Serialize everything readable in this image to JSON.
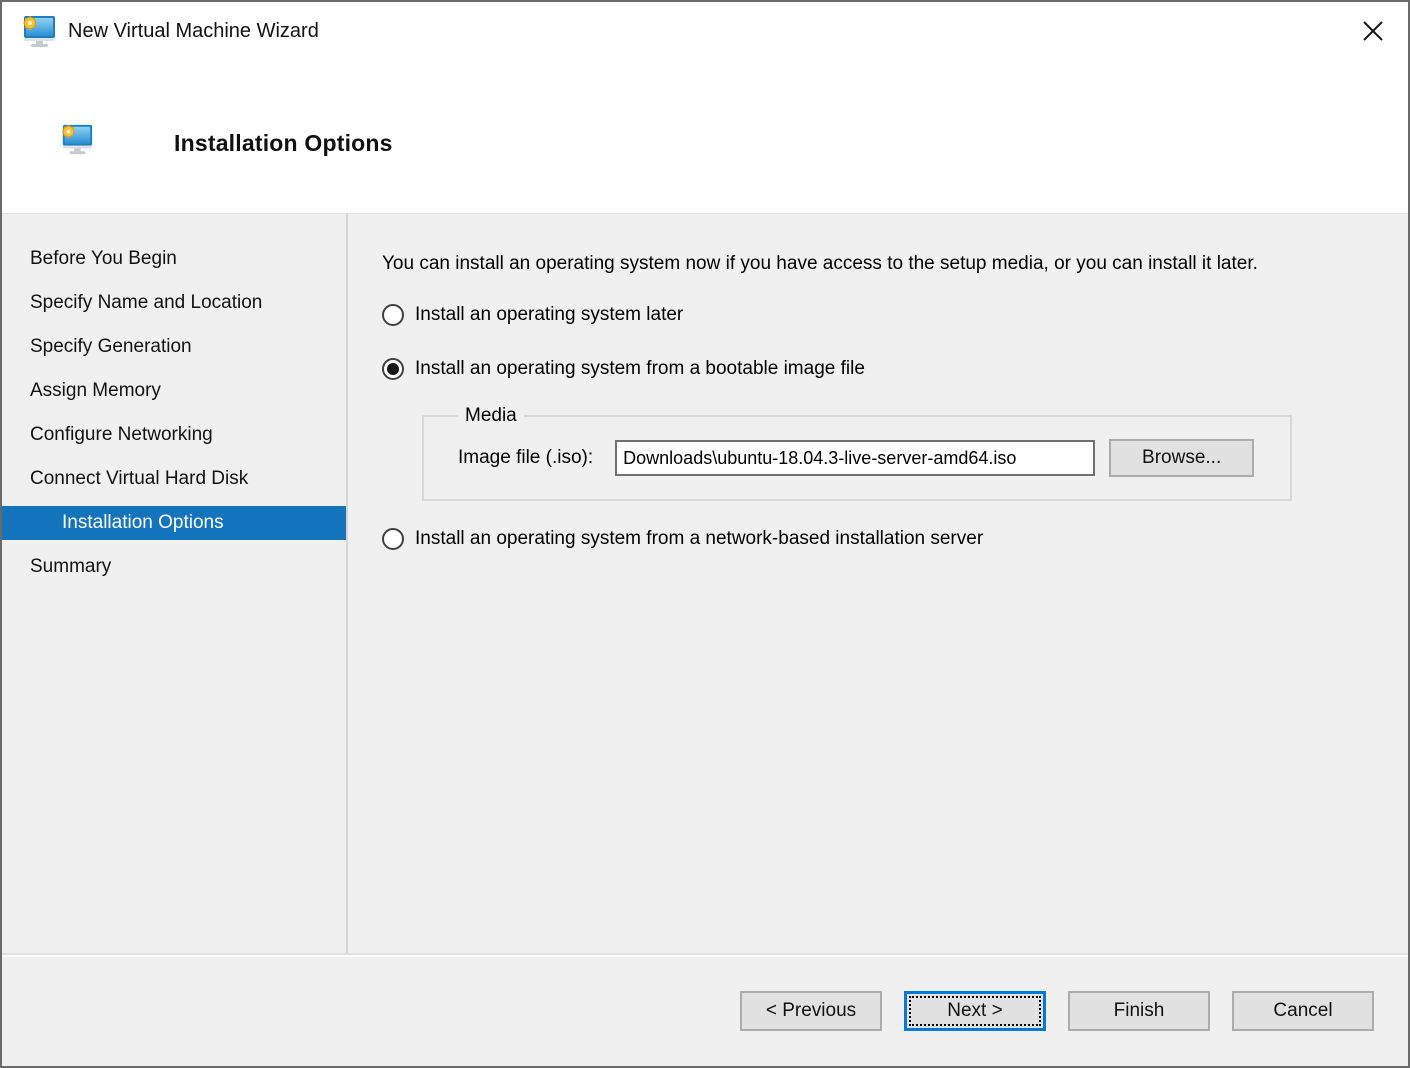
{
  "window": {
    "title": "New Virtual Machine Wizard"
  },
  "header": {
    "title": "Installation Options"
  },
  "sidebar": {
    "items": [
      {
        "label": "Before You Begin",
        "selected": false
      },
      {
        "label": "Specify Name and Location",
        "selected": false
      },
      {
        "label": "Specify Generation",
        "selected": false
      },
      {
        "label": "Assign Memory",
        "selected": false
      },
      {
        "label": "Configure Networking",
        "selected": false
      },
      {
        "label": "Connect Virtual Hard Disk",
        "selected": false
      },
      {
        "label": "Installation Options",
        "selected": true
      },
      {
        "label": "Summary",
        "selected": false
      }
    ]
  },
  "content": {
    "intro": "You can install an operating system now if you have access to the setup media, or you can install it later.",
    "options": [
      {
        "label": "Install an operating system later",
        "selected": false
      },
      {
        "label": "Install an operating system from a bootable image file",
        "selected": true
      },
      {
        "label": "Install an operating system from a network-based installation server",
        "selected": false
      }
    ],
    "media": {
      "legend": "Media",
      "image_file_label": "Image file (.iso):",
      "image_file_value": "Downloads\\ubuntu-18.04.3-live-server-amd64.iso",
      "browse_label": "Browse..."
    }
  },
  "footer": {
    "previous_label": "< Previous",
    "next_label": "Next >",
    "finish_label": "Finish",
    "cancel_label": "Cancel"
  },
  "colors": {
    "sidebar_selected_bg": "#1474bb",
    "focus_border_blue": "#0078d7",
    "body_bg": "#f0f0f0",
    "button_bg": "#e1e1e1",
    "gear_yellow": "#f2b322",
    "monitor_blue": "#3fa3e3"
  }
}
